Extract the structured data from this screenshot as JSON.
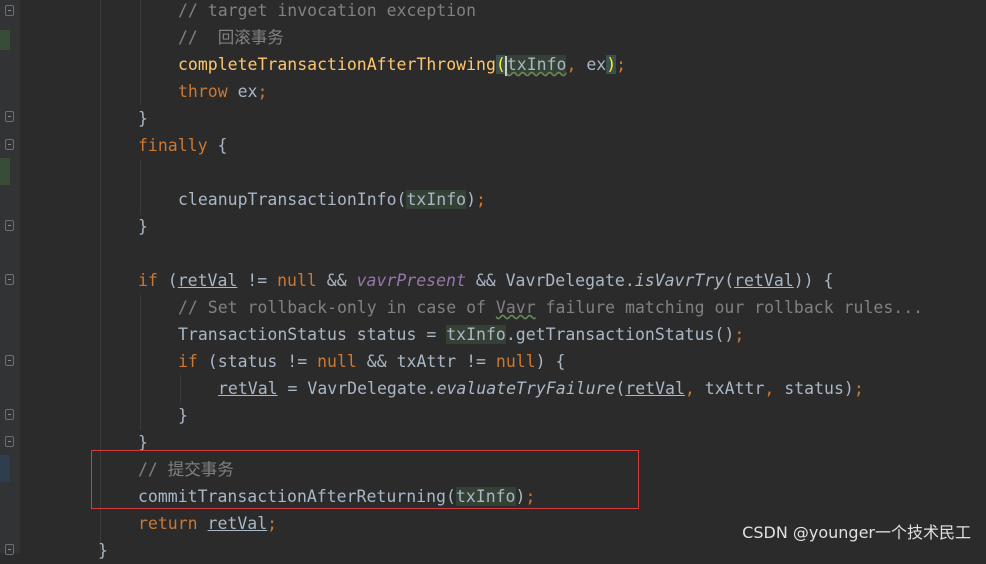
{
  "editor": {
    "theme": "darcula",
    "lines": [
      {
        "segments": [
          "// target invocation exception"
        ]
      },
      {
        "segments": [
          "//  回滚事务"
        ]
      },
      {
        "segments": [
          "completeTransactionAfterThrowing",
          "(",
          "txInfo",
          ", ",
          "ex",
          ")",
          ";"
        ]
      },
      {
        "segments": [
          "throw",
          " ex",
          ";"
        ]
      },
      {
        "segments": [
          "}"
        ]
      },
      {
        "segments": [
          "finally",
          " {"
        ]
      },
      {
        "segments": [
          "cleanupTransactionInfo",
          "(",
          "txInfo",
          ")",
          ";"
        ]
      },
      {
        "segments": [
          "}"
        ]
      },
      {
        "segments": [
          "if",
          " (",
          "retVal",
          " != ",
          "null",
          " && ",
          "vavrPresent",
          " && VavrDelegate.",
          "isVavrTry",
          "(",
          "retVal",
          ")) {"
        ]
      },
      {
        "segments": [
          "// Set rollback-only in case of ",
          "Vavr",
          " failure matching our rollback rules..."
        ]
      },
      {
        "segments": [
          "TransactionStatus status = ",
          "txInfo",
          ".getTransactionStatus()",
          ";"
        ]
      },
      {
        "segments": [
          "if",
          " (status != ",
          "null",
          " && txAttr != ",
          "null",
          ") {"
        ]
      },
      {
        "segments": [
          "retVal",
          " = VavrDelegate.",
          "evaluateTryFailure",
          "(",
          "retVal",
          ", ",
          "txAttr",
          ", ",
          "status",
          ")",
          ";"
        ]
      },
      {
        "segments": [
          "}"
        ]
      },
      {
        "segments": [
          "}"
        ]
      },
      {
        "segments": [
          "// 提交事务"
        ]
      },
      {
        "segments": [
          "commitTransactionAfterReturning",
          "(",
          "txInfo",
          ")",
          ";"
        ]
      },
      {
        "segments": [
          "return",
          " ",
          "retVal",
          ";"
        ]
      },
      {
        "segments": [
          "}"
        ]
      }
    ]
  },
  "watermark": "CSDN @younger一个技术民工",
  "colors": {
    "background": "#2b2b2b",
    "keyword": "#cc7832",
    "comment": "#808080",
    "identifier": "#a9b7c6",
    "static_field": "#9876aa",
    "highlight_box": "#d13b3b"
  }
}
